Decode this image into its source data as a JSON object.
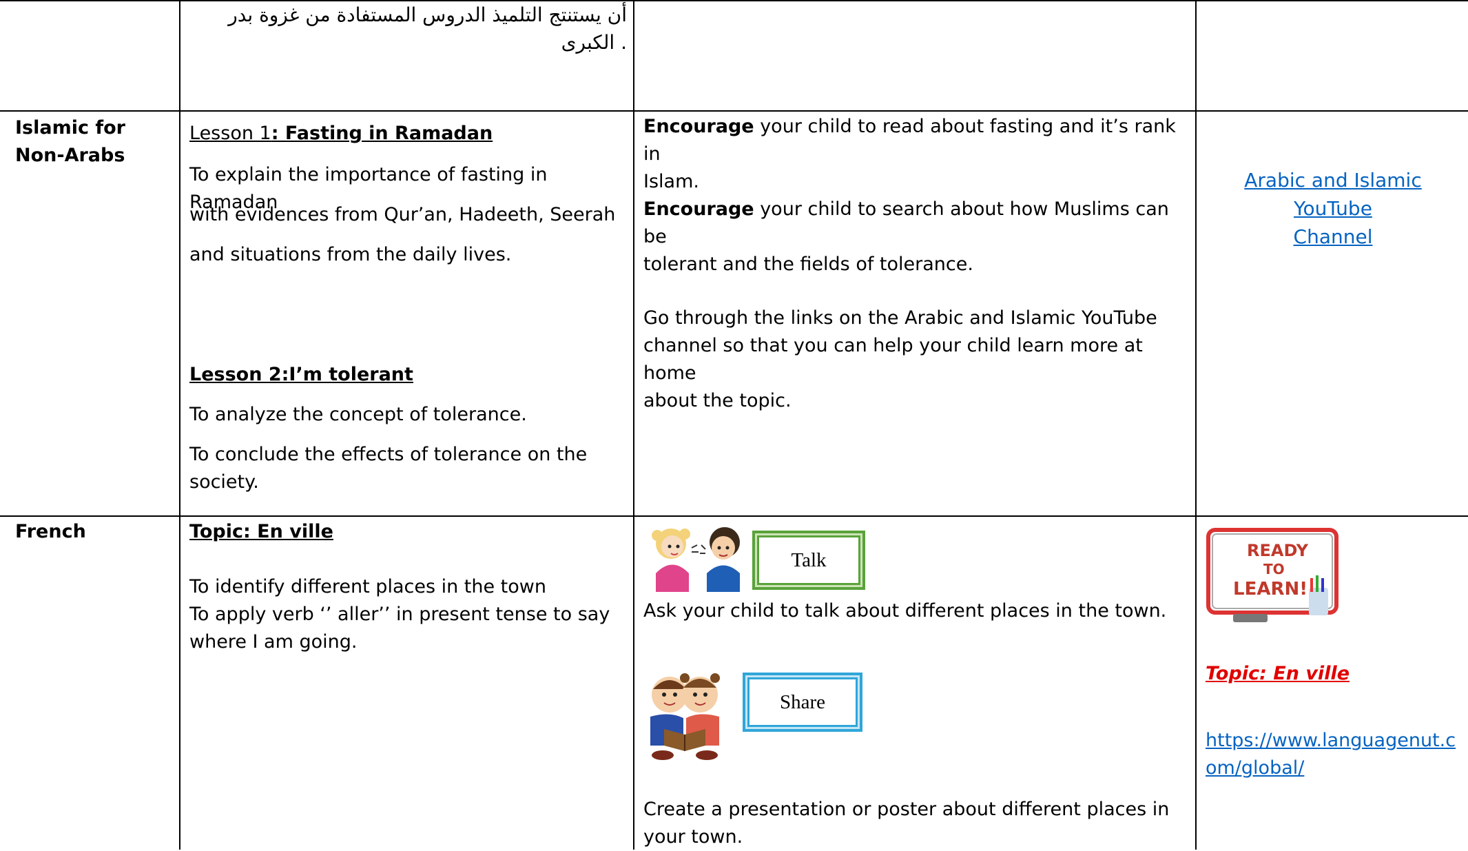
{
  "top_row": {
    "arabic_line1": "أن يستنتج التلميذ الدروس المستفادة من غزوة بدر",
    "arabic_line2": ". الكبرى"
  },
  "islamic": {
    "subject": "Islamic for Non-Arabs",
    "lesson1_prefix": "Lesson 1",
    "lesson1_title": ": Fasting in Ramadan",
    "obj1_l1": "To explain the importance of fasting in Ramadan",
    "obj1_l2": "with evidences from Qur’an, Hadeeth, Seerah",
    "obj1_l3": "and situations from the daily lives.",
    "lesson2_title": "Lesson 2:I’m tolerant",
    "obj2": "To analyze the concept of tolerance.",
    "obj3_l1": "To conclude the effects of tolerance on the",
    "obj3_l2": "society.",
    "enc1_bold": "Encourage",
    "enc1_rest_l1": " your child to read about fasting and it’s rank in",
    "enc1_l2": "Islam.",
    "enc2_bold": "Encourage",
    "enc2_rest_l1": " your child to search about how Muslims can be",
    "enc2_l2": "tolerant and the fields of tolerance.",
    "links_l1": "Go through the links on the Arabic and Islamic YouTube",
    "links_l2": "channel so that you can help your child learn more at home",
    "links_l3": "about the topic.",
    "resource_l1": "Arabic and Islamic YouTube",
    "resource_l2": "Channel"
  },
  "french": {
    "subject": "French",
    "topic": "Topic: En ville",
    "obj1": "To identify different places in the town",
    "obj2_l1": "To apply verb ‘’ aller’’ in present tense to say",
    "obj2_l2": "where I am going.",
    "talk_label": "Talk",
    "talk_text": "Ask your child to talk about different places in the town.",
    "share_label": "Share",
    "share_l1": "Create a presentation or poster about different places in",
    "share_l2": "your town.",
    "ready_sign": "READY TO LEARN!",
    "resource_topic": "Topic: En ville",
    "link_l1": "https://www.languagenut.c",
    "link_l2": "om/global/"
  },
  "colors": {
    "link": "#0563c1",
    "red_topic": "#e00000",
    "talk_border": "#5aa23a",
    "share_border": "#2fa6d9"
  }
}
